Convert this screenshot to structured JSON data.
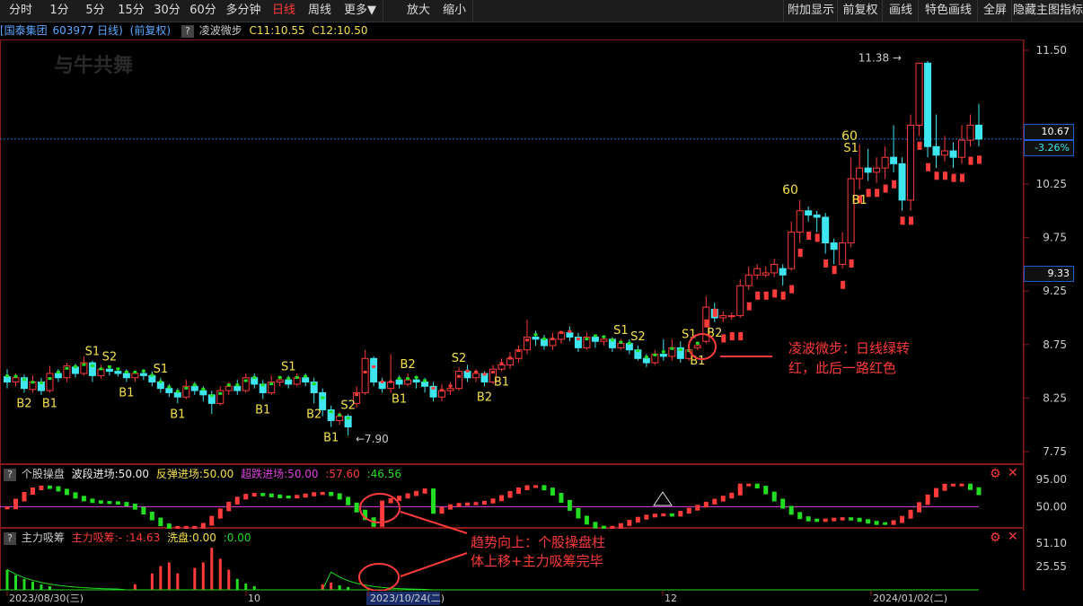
{
  "toolbar": {
    "left": [
      "分时",
      "1分",
      "5分",
      "15分",
      "30分",
      "60分",
      "多分钟",
      "日线",
      "周线",
      "更多▼",
      "放大",
      "缩小"
    ],
    "active": "日线",
    "right": [
      "附加显示",
      "前复权",
      "画线",
      "特色画线",
      "全屏",
      "隐藏主图指标"
    ]
  },
  "header": {
    "stock": "[国泰集团",
    "code": "603977",
    "period": "日线)",
    "adjust": "(前复权)",
    "help": "?",
    "indicator": "凌波微步",
    "c11": "C11:10.55",
    "c12": "C12:10.50"
  },
  "watermark": "与牛共舞",
  "price_axis": {
    "ticks": [
      "11.50",
      "10.25",
      "9.75",
      "9.25",
      "8.75",
      "8.25",
      "7.75"
    ],
    "current": "10.67",
    "change": "-3.26%",
    "cursor": "9.33"
  },
  "annotations": {
    "high": "11.38",
    "low": "7.90",
    "sixty_1": "60",
    "sixty_2": "60",
    "main_note_1": "凌波微步：日线绿转",
    "main_note_2": "红，此后一路红色",
    "sub_note_1": "趋势向上：个股操盘柱",
    "sub_note_2": "体上移+主力吸筹完毕"
  },
  "indicator1": {
    "help": "?",
    "name": "个股操盘",
    "v1": "波段进场:50.00",
    "v2": "反弹进场:50.00",
    "v3": "超跌进场:50.00",
    "v4": ":57.60",
    "v5": ":46.56",
    "ticks": [
      "95.00",
      "50.00"
    ]
  },
  "indicator2": {
    "help": "?",
    "name": "主力吸筹",
    "v1": "主力吸筹:-",
    "v2": ":14.63",
    "v3": "洗盘:0.00",
    "v4": ":0.00",
    "ticks": [
      "51.10",
      "25.55"
    ]
  },
  "date_axis": {
    "labels": [
      "2023/08/30(三)",
      "10",
      "2023/10/24(二)",
      "12",
      "2024/01/02(二)"
    ]
  },
  "colors": {
    "up": "#ff3b3b",
    "down": "#3ee6f0",
    "yellow": "#f5e04a",
    "magenta": "#e040e0",
    "green": "#22dd22",
    "grid": "#2a2a2a"
  },
  "chart_data": {
    "type": "candlestick",
    "price_range": [
      7.75,
      11.5
    ],
    "candles": [
      [
        8.45,
        8.4,
        8.52,
        8.34
      ],
      [
        8.4,
        8.44,
        8.48,
        8.36
      ],
      [
        8.44,
        8.34,
        8.47,
        8.3
      ],
      [
        8.33,
        8.4,
        8.46,
        8.3
      ],
      [
        8.4,
        8.32,
        8.44,
        8.28
      ],
      [
        8.32,
        8.48,
        8.55,
        8.3
      ],
      [
        8.48,
        8.44,
        8.52,
        8.4
      ],
      [
        8.44,
        8.55,
        8.58,
        8.4
      ],
      [
        8.54,
        8.48,
        8.57,
        8.44
      ],
      [
        8.48,
        8.58,
        8.64,
        8.46
      ],
      [
        8.58,
        8.46,
        8.6,
        8.4
      ],
      [
        8.46,
        8.52,
        8.56,
        8.43
      ],
      [
        8.52,
        8.5,
        8.55,
        8.46
      ],
      [
        8.5,
        8.48,
        8.53,
        8.45
      ],
      [
        8.48,
        8.44,
        8.52,
        8.4
      ],
      [
        8.44,
        8.48,
        8.51,
        8.4
      ],
      [
        8.48,
        8.46,
        8.52,
        8.42
      ],
      [
        8.46,
        8.4,
        8.5,
        8.36
      ],
      [
        8.4,
        8.34,
        8.44,
        8.3
      ],
      [
        8.34,
        8.3,
        8.38,
        8.26
      ],
      [
        8.3,
        8.26,
        8.34,
        8.2
      ],
      [
        8.26,
        8.36,
        8.42,
        8.24
      ],
      [
        8.36,
        8.32,
        8.4,
        8.28
      ],
      [
        8.32,
        8.28,
        8.36,
        8.22
      ],
      [
        8.28,
        8.2,
        8.32,
        8.1
      ],
      [
        8.2,
        8.32,
        8.36,
        8.18
      ],
      [
        8.32,
        8.36,
        8.4,
        8.28
      ],
      [
        8.36,
        8.32,
        8.42,
        8.28
      ],
      [
        8.32,
        8.44,
        8.48,
        8.3
      ],
      [
        8.44,
        8.38,
        8.48,
        8.34
      ],
      [
        8.38,
        8.3,
        8.42,
        8.24
      ],
      [
        8.3,
        8.4,
        8.46,
        8.28
      ],
      [
        8.4,
        8.42,
        8.46,
        8.36
      ],
      [
        8.42,
        8.38,
        8.46,
        8.34
      ],
      [
        8.38,
        8.44,
        8.48,
        8.36
      ],
      [
        8.44,
        8.4,
        8.48,
        8.36
      ],
      [
        8.4,
        8.3,
        8.44,
        8.2
      ],
      [
        8.3,
        8.14,
        8.34,
        8.08
      ],
      [
        8.14,
        8.04,
        8.18,
        7.98
      ],
      [
        8.04,
        8.08,
        8.12,
        8.0
      ],
      [
        8.08,
        7.98,
        8.1,
        7.9
      ],
      [
        8.2,
        8.3,
        8.36,
        8.16
      ],
      [
        8.3,
        8.62,
        8.7,
        8.28
      ],
      [
        8.62,
        8.4,
        8.64,
        8.36
      ],
      [
        8.4,
        8.34,
        8.44,
        8.3
      ],
      [
        8.34,
        8.4,
        8.66,
        8.3
      ],
      [
        8.42,
        8.38,
        8.46,
        8.34
      ],
      [
        8.38,
        8.42,
        8.48,
        8.36
      ],
      [
        8.42,
        8.4,
        8.46,
        8.34
      ],
      [
        8.4,
        8.36,
        8.44,
        8.3
      ],
      [
        8.36,
        8.26,
        8.4,
        8.22
      ],
      [
        8.26,
        8.32,
        8.38,
        8.22
      ],
      [
        8.32,
        8.34,
        8.4,
        8.28
      ],
      [
        8.34,
        8.5,
        8.54,
        8.32
      ],
      [
        8.5,
        8.44,
        8.56,
        8.4
      ],
      [
        8.44,
        8.48,
        8.52,
        8.4
      ],
      [
        8.48,
        8.4,
        8.5,
        8.36
      ],
      [
        8.4,
        8.52,
        8.56,
        8.38
      ],
      [
        8.52,
        8.56,
        8.62,
        8.5
      ],
      [
        8.56,
        8.62,
        8.68,
        8.52
      ],
      [
        8.62,
        8.7,
        8.74,
        8.58
      ],
      [
        8.7,
        8.82,
        8.98,
        8.66
      ],
      [
        8.82,
        8.8,
        8.88,
        8.74
      ],
      [
        8.8,
        8.74,
        8.84,
        8.7
      ],
      [
        8.74,
        8.8,
        8.86,
        8.7
      ],
      [
        8.8,
        8.86,
        8.88,
        8.76
      ],
      [
        8.86,
        8.82,
        8.92,
        8.78
      ],
      [
        8.82,
        8.72,
        8.86,
        8.68
      ],
      [
        8.72,
        8.82,
        8.86,
        8.7
      ],
      [
        8.82,
        8.78,
        8.84,
        8.72
      ],
      [
        8.78,
        8.8,
        8.84,
        8.74
      ],
      [
        8.8,
        8.72,
        8.82,
        8.68
      ],
      [
        8.72,
        8.76,
        8.8,
        8.7
      ],
      [
        8.76,
        8.7,
        8.8,
        8.66
      ],
      [
        8.7,
        8.62,
        8.74,
        8.6
      ],
      [
        8.62,
        8.58,
        8.66,
        8.54
      ],
      [
        8.58,
        8.66,
        8.7,
        8.56
      ],
      [
        8.66,
        8.64,
        8.8,
        8.6
      ],
      [
        8.64,
        8.72,
        8.8,
        8.6
      ],
      [
        8.72,
        8.62,
        8.78,
        8.58
      ],
      [
        8.62,
        8.7,
        8.76,
        8.6
      ],
      [
        8.72,
        8.74,
        8.78,
        8.7
      ],
      [
        8.78,
        9.1,
        9.2,
        8.76
      ],
      [
        9.08,
        9.0,
        9.14,
        8.96
      ],
      [
        9.0,
        9.02,
        9.06,
        8.96
      ],
      [
        9.02,
        9.02,
        9.05,
        8.98
      ],
      [
        9.02,
        9.3,
        9.36,
        9.0
      ],
      [
        9.3,
        9.4,
        9.48,
        9.26
      ],
      [
        9.4,
        9.46,
        9.5,
        9.36
      ],
      [
        9.4,
        9.42,
        9.48,
        9.38
      ],
      [
        9.42,
        9.5,
        9.55,
        9.38
      ],
      [
        9.46,
        9.4,
        9.5,
        9.3
      ],
      [
        9.46,
        9.8,
        9.9,
        9.44
      ],
      [
        9.8,
        10.0,
        10.1,
        9.7
      ],
      [
        10.0,
        9.96,
        10.04,
        9.9
      ],
      [
        9.96,
        9.94,
        10.0,
        9.8
      ],
      [
        9.94,
        9.7,
        9.98,
        9.6
      ],
      [
        9.7,
        9.64,
        9.74,
        9.5
      ],
      [
        9.5,
        9.7,
        9.8,
        9.46
      ],
      [
        9.7,
        10.3,
        10.5,
        9.66
      ],
      [
        10.3,
        10.4,
        10.62,
        10.2
      ],
      [
        10.4,
        10.36,
        10.58,
        10.28
      ],
      [
        10.36,
        10.4,
        10.5,
        10.26
      ],
      [
        10.4,
        10.5,
        10.6,
        10.3
      ],
      [
        10.5,
        10.44,
        10.8,
        10.36
      ],
      [
        10.44,
        10.1,
        10.5,
        10.0
      ],
      [
        10.1,
        10.8,
        10.9,
        10.0
      ],
      [
        10.8,
        11.38,
        11.38,
        10.7
      ],
      [
        11.38,
        10.6,
        11.4,
        10.5
      ],
      [
        10.6,
        10.52,
        10.9,
        10.4
      ],
      [
        10.52,
        10.56,
        10.7,
        10.46
      ],
      [
        10.56,
        10.5,
        10.64,
        10.4
      ],
      [
        10.5,
        10.66,
        10.8,
        10.44
      ],
      [
        10.66,
        10.8,
        10.9,
        10.6
      ],
      [
        10.8,
        10.67,
        11.0,
        10.6
      ]
    ]
  }
}
